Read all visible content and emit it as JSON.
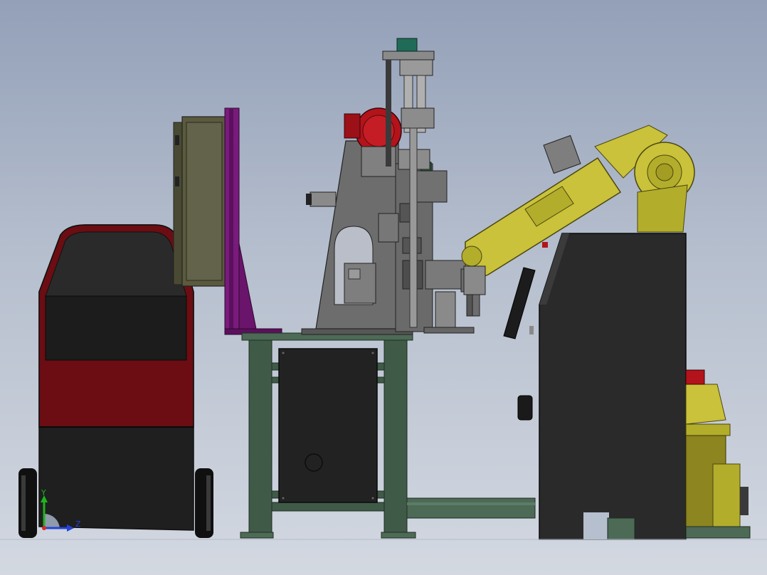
{
  "viewport": {
    "background_top": "#93a0b8",
    "background_bottom": "#d3d8e1"
  },
  "colors": {
    "robot_yellow": "#c9c23a",
    "robot_yellow_dark": "#8c8520",
    "machine_gray": "#6d6d6d",
    "frame_green": "#3f5a47",
    "cabinet_black": "#252525",
    "cart_red": "#6b0d12",
    "purple_guard": "#7a1a7d",
    "olive_panel": "#5b5a3e",
    "motor_red": "#b3131b"
  },
  "triad": {
    "y_label": "Y",
    "z_label": "Z",
    "y_color": "#1fb31f",
    "z_color": "#2444d6",
    "x_color": "#d62a2a"
  }
}
